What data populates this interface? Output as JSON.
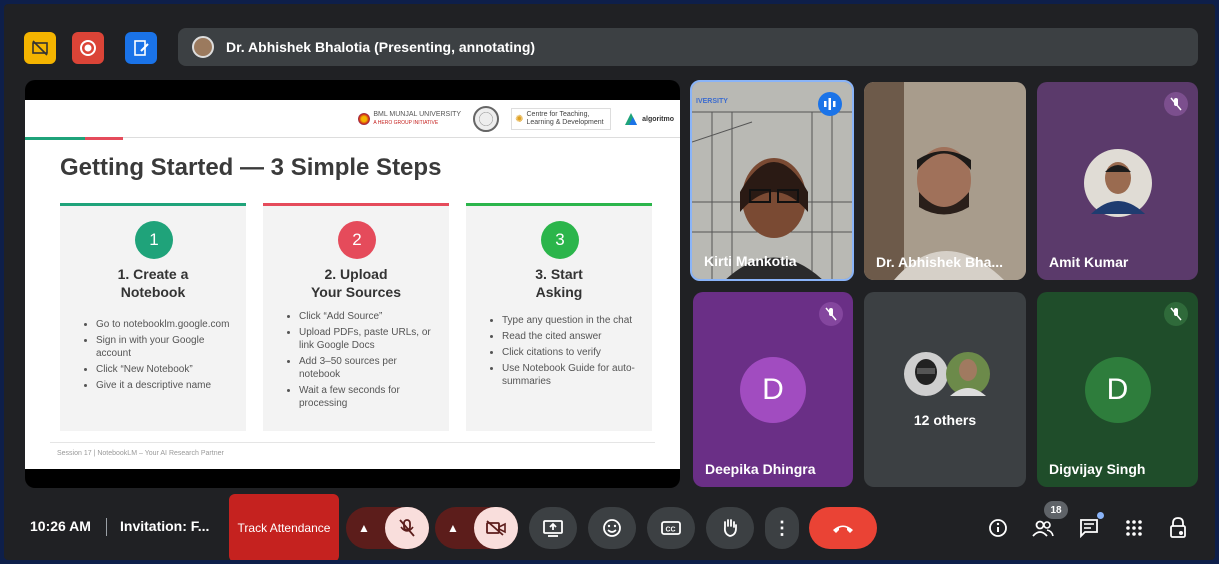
{
  "presenter_bar": {
    "text": "Dr. Abhishek Bhalotia (Presenting, annotating)"
  },
  "top_buttons": [
    {
      "icon": "no-caption-icon",
      "color": "#f4b400"
    },
    {
      "icon": "record-icon",
      "color": "#db4437"
    },
    {
      "icon": "edit-doc-icon",
      "color": "#1a73e8"
    }
  ],
  "slide": {
    "logos": {
      "bml": "BML MUNJAL UNIVERSITY",
      "bml_sub": "A HERO GROUP INITIATIVE",
      "ctld": "Centre for Teaching, Learning & Development",
      "algo": "algoritmo"
    },
    "title": "Getting Started — 3 Simple Steps",
    "cards": [
      {
        "num": "1",
        "color": "#1fa37a",
        "heading_1": "1. Create a",
        "heading_2": "Notebook",
        "items": [
          "Go to notebooklm.google.com",
          "Sign in with your Google account",
          "Click “New Notebook”",
          "Give it a descriptive name"
        ]
      },
      {
        "num": "2",
        "color": "#e54b5b",
        "heading_1": "2. Upload",
        "heading_2": "Your Sources",
        "items": [
          "Click “Add Source”",
          "Upload PDFs, paste URLs, or link Google Docs",
          "Add 3–50 sources per notebook",
          "Wait a few seconds for processing"
        ]
      },
      {
        "num": "3",
        "color": "#2bb54b",
        "heading_1": "3. Start",
        "heading_2": "Asking",
        "items": [
          "Type any question in the chat",
          "Read the cited answer",
          "Click citations to verify",
          "Use Notebook Guide for auto-summaries"
        ]
      }
    ],
    "footer": "Session 17  |  NotebookLM – Your AI Research Partner"
  },
  "participants": {
    "kirti": "Kirti Mankotia",
    "kirti_bg_text": "IVERSITY",
    "abhishek": "Dr. Abhishek Bha...",
    "amit": "Amit Kumar",
    "deepika": "Deepika Dhingra",
    "deepika_initial": "D",
    "others": "12 others",
    "digvijay": "Digvijay Singh",
    "digvijay_initial": "D"
  },
  "bottom": {
    "time": "10:26 AM",
    "invite": "Invitation: F...",
    "track": "Track Attendance",
    "people_count": "18"
  }
}
